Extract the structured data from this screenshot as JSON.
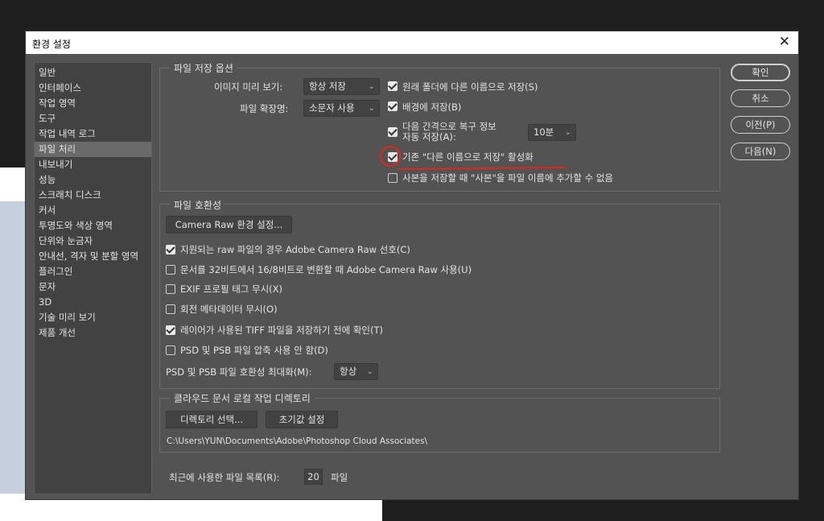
{
  "dialog": {
    "title": "환경 설정",
    "close": "✕"
  },
  "sidebar": {
    "items": [
      "일반",
      "인터페이스",
      "작업 영역",
      "도구",
      "작업 내역 로그",
      "파일 처리",
      "내보내기",
      "성능",
      "스크래치 디스크",
      "커서",
      "투명도와 색상 영역",
      "단위와 눈금자",
      "안내선, 격자 및 분할 영역",
      "플러그인",
      "문자",
      "3D",
      "기술 미리 보기",
      "제품 개선"
    ],
    "selected_index": 5
  },
  "file_save": {
    "legend": "파일 저장 옵션",
    "image_preview_label": "이미지 미리 보기:",
    "image_preview_value": "항상 저장",
    "ext_label": "파일 확장명:",
    "ext_value": "소문자 사용",
    "opt_save_as_original": "원래 폴더에 다른 이름으로 저장(S)",
    "opt_save_background": "배경에 저장(B)",
    "opt_auto_save_line1": "다음 간격으로 복구 정보",
    "opt_auto_save_line2": "자동 저장(A):",
    "auto_save_interval": "10분",
    "opt_legacy_save_as": "기존 \"다른 이름으로 저장\" 활성화",
    "opt_no_copy_suffix": "사본을 저장할 때 \"사본\"을 파일 이름에 추가할 수 없음",
    "checked": {
      "save_as_original": true,
      "save_background": true,
      "auto_save": true,
      "legacy_save_as": true,
      "no_copy_suffix": false
    }
  },
  "compat": {
    "legend": "파일 호환성",
    "camera_raw_button": "Camera Raw 환경 설정...",
    "opt1": "지원되는 raw 파일의 경우 Adobe Camera Raw 선호(C)",
    "opt2": "문서를 32비트에서 16/8비트로 변환할 때 Adobe Camera Raw 사용(U)",
    "opt3": "EXIF 프로필 태그 무시(X)",
    "opt4": "회전 메타데이터 무시(O)",
    "opt5": "레이어가 사용된 TIFF 파일을 저장하기 전에 확인(T)",
    "opt6": "PSD 및 PSB 파일 압축 사용 안 함(D)",
    "checked": [
      true,
      false,
      false,
      false,
      true,
      false
    ],
    "maximize_label": "PSD 및 PSB 파일 호환성 최대화(M):",
    "maximize_value": "항상"
  },
  "cloud": {
    "legend": "클라우드 문서 로컬 작업 디렉토리",
    "choose_dir_button": "디렉토리 선택...",
    "reset_button": "초기값 설정",
    "path": "C:\\Users\\YUN\\Documents\\Adobe\\Photoshop Cloud Associates\\"
  },
  "recent": {
    "label": "최근에 사용한 파일 목록(R):",
    "value": "20",
    "unit": "파일"
  },
  "buttons": {
    "ok": "확인",
    "cancel": "취소",
    "prev": "이전(P)",
    "next": "다음(N)"
  },
  "icons": {
    "checkbox_checked": "checkmark-icon",
    "dropdown": "chevron-down-icon",
    "close": "close-icon"
  },
  "colors": {
    "dialog_bg": "#535353",
    "panel_bg": "#424242",
    "annotation": "#e0261e"
  }
}
